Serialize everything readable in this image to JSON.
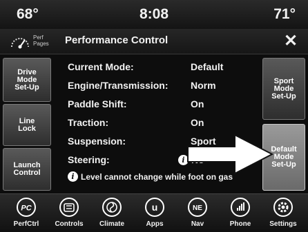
{
  "status_bar": {
    "temp_left": "68°",
    "clock": "8:08",
    "temp_right": "71°"
  },
  "header": {
    "perf_pages_label": "Perf\nPages",
    "title": "Performance Control",
    "close_symbol": "✕"
  },
  "left_buttons": [
    {
      "label": "Drive\nMode\nSet-Up"
    },
    {
      "label": "Line\nLock"
    },
    {
      "label": "Launch\nControl"
    }
  ],
  "right_buttons": [
    {
      "label": "Sport\nMode\nSet-Up"
    },
    {
      "label": "Default\nMode\nSet-Up"
    }
  ],
  "settings": [
    {
      "label": "Current Mode:",
      "value": "Default"
    },
    {
      "label": "Engine/Transmission:",
      "value": "Norm"
    },
    {
      "label": "Paddle Shift:",
      "value": "On"
    },
    {
      "label": "Traction:",
      "value": "On"
    },
    {
      "label": "Suspension:",
      "value": "Sport"
    },
    {
      "label": "Steering:",
      "value": "No"
    }
  ],
  "info_glyph": "i",
  "warning": "Level cannot change while foot on gas",
  "nav": [
    {
      "label": "PerfCtrl",
      "icon": "perf-control-icon",
      "glyph": "PC"
    },
    {
      "label": "Controls",
      "icon": "controls-icon"
    },
    {
      "label": "Climate",
      "icon": "climate-icon"
    },
    {
      "label": "Apps",
      "icon": "apps-icon",
      "glyph": "u"
    },
    {
      "label": "Nav",
      "icon": "compass-icon",
      "glyph": "NE"
    },
    {
      "label": "Phone",
      "icon": "phone-icon"
    },
    {
      "label": "Settings",
      "icon": "settings-gear-icon"
    }
  ]
}
